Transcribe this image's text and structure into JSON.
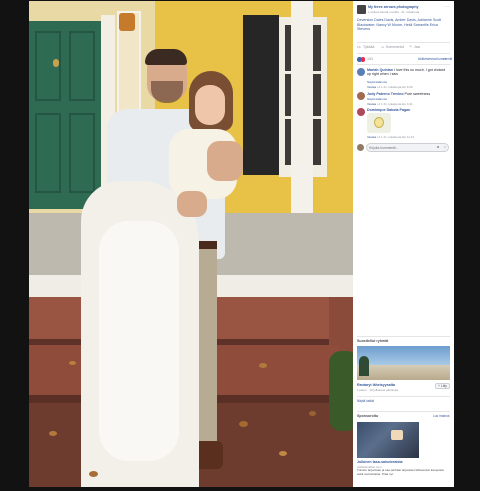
{
  "post": {
    "page_name": "My three arrows photography",
    "post_meta": "1 elokuu kautta emoilla · 21. lokakuuta · ",
    "caption": "Deversion Dales Davis, Amber Davis, Adrianne Scott Blackwater, Nancy W Moore, Heidi Sarrantile Erica Stevens",
    "actions": {
      "like": "Tykkää",
      "comment": "Kommentoi",
      "share": "Jaa"
    },
    "reaction_count": "163",
    "sort_label": "Aktiivisimmat kommentit",
    "sort_caret": "▾"
  },
  "comments": [
    {
      "author": "Mariah Quinlan",
      "text": "I love this so much. I got choked up right when I saw",
      "translate": "Näytä käännös",
      "reply": "Vastaa",
      "likes": "1",
      "time": "21. lokakuuta klo 8.26",
      "avatar_color": "#5a7fb5"
    },
    {
      "author": "Jody Paterno Trevino",
      "text": "Pure sweetness",
      "translate": "Näytä käännös",
      "reply": "Vastaa",
      "likes": "1",
      "time": "21. lokakuuta klo 9.41",
      "avatar_color": "#a06a4f"
    },
    {
      "author": "Dominique Dakota Pagan",
      "text": "",
      "translate": "",
      "reply": "Vastaa",
      "likes": "1",
      "time": "21. lokakuuta klo 11.13",
      "avatar_color": "#b0475c"
    }
  ],
  "comment_input": {
    "placeholder": "Kirjoita kommentti..."
  },
  "suggested": {
    "title": "Suositellut ryhmät",
    "group_name": "Rantaryt läheisyysalta",
    "group_members": "1 jäsen · 10 julkaisua päivässä",
    "join_label": "+ Liity",
    "see_all": "Näytä kaikki"
  },
  "sponsored": {
    "title": "Sponsoroitu",
    "create_ad": "Luo mainos",
    "ad_title": "Julkinen tasa-saisvieraista",
    "ad_domain": "olahelsinkifoo.com",
    "ad_text": "Tutustu tarjontaan ja saa parhaat tarjoukset lähiseudun kaupoista sekä ravintoloista. Tilaa nyt."
  },
  "colors": {
    "link": "#365899",
    "accent": "#4267b2",
    "panel_bg": "#ffffff",
    "viewer_bg": "#121212"
  }
}
